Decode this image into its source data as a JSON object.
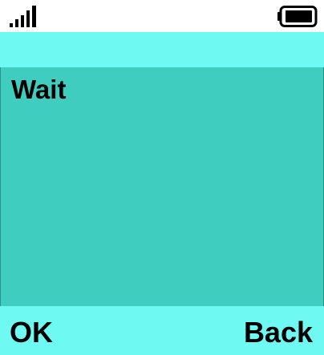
{
  "status_bar": {
    "signal_icon": "signal-strength-icon",
    "signal_bars": 5,
    "battery_icon": "battery-icon",
    "battery_level": 1.0
  },
  "title_bar": {
    "title": ""
  },
  "content": {
    "message": "Wait"
  },
  "softkeys": {
    "left_label": "OK",
    "right_label": "Back"
  },
  "colors": {
    "header_background": "#6ff9f3",
    "content_background": "#3fcdc0",
    "text": "#000000"
  }
}
